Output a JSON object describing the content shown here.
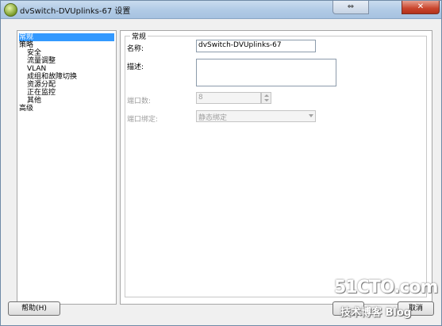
{
  "window": {
    "title": "dvSwitch-DVUplinks-67 设置",
    "controls": {
      "restore_glyph": "⇔",
      "close_glyph": "✕"
    }
  },
  "tree": {
    "items": [
      {
        "label": "常规",
        "selected": true
      },
      {
        "label": "策略"
      },
      {
        "label": "安全"
      },
      {
        "label": "流量调整"
      },
      {
        "label": "VLAN"
      },
      {
        "label": "成组和故障切换"
      },
      {
        "label": "资源分配"
      },
      {
        "label": "正在监控"
      },
      {
        "label": "其他"
      },
      {
        "label": "高级"
      }
    ]
  },
  "general": {
    "group_title": "常规",
    "name_label": "名称:",
    "name_value": "dvSwitch-DVUplinks-67",
    "description_label": "描述:",
    "description_value": "",
    "ports_label": "端口数:",
    "ports_value": "8",
    "port_binding_label": "端口绑定:",
    "port_binding_value": "静态绑定"
  },
  "buttons": {
    "help": "帮助(H)",
    "cancel": "取消"
  },
  "watermark": {
    "line1": "51CTO.com",
    "line2": "技术博客 Blog"
  }
}
